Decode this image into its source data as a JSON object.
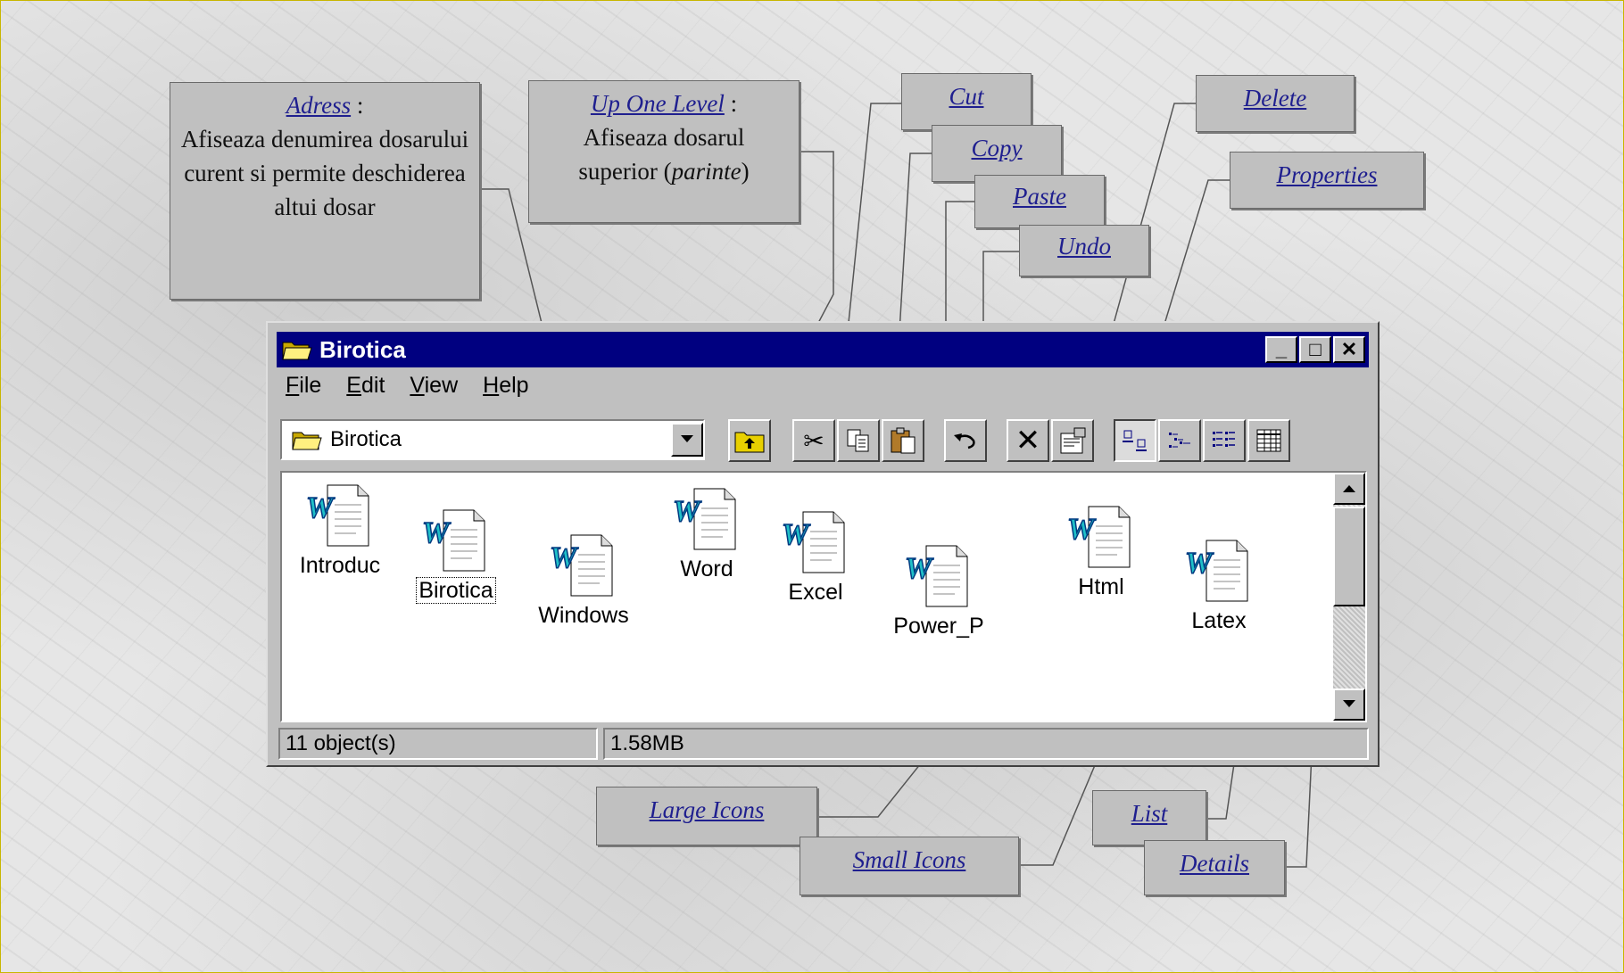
{
  "callouts": {
    "adress": {
      "title": "Adress",
      "suffix": " :",
      "body": "Afiseaza denumirea dosarului curent si permite deschiderea altui dosar"
    },
    "up_one_level": {
      "title": "Up One Level",
      "suffix": " :",
      "body_prefix": "Afiseaza dosarul superior (",
      "body_italic": "parinte",
      "body_suffix": ")"
    },
    "cut": {
      "title": "Cut"
    },
    "copy": {
      "title": "Copy"
    },
    "paste": {
      "title": "Paste"
    },
    "undo": {
      "title": "Undo"
    },
    "delete": {
      "title": "Delete"
    },
    "properties": {
      "title": "Properties"
    },
    "large_icons": {
      "title": "Large Icons"
    },
    "small_icons": {
      "title": "Small Icons"
    },
    "list": {
      "title": "List"
    },
    "details": {
      "title": "Details"
    }
  },
  "window": {
    "title": "Birotica",
    "controls": {
      "minimize": "_",
      "maximize": "□",
      "close": "✕"
    },
    "menu": [
      {
        "label": "File",
        "accel": "F",
        "rest": "ile"
      },
      {
        "label": "Edit",
        "accel": "E",
        "rest": "dit"
      },
      {
        "label": "View",
        "accel": "V",
        "rest": "iew"
      },
      {
        "label": "Help",
        "accel": "H",
        "rest": "elp"
      }
    ],
    "address_value": "Birotica",
    "toolbar": [
      "up-one-level-icon",
      "cut-icon",
      "copy-icon",
      "paste-icon",
      "undo-icon",
      "delete-icon",
      "properties-icon",
      "large-icons-icon",
      "small-icons-icon",
      "list-icon",
      "details-icon"
    ],
    "files": [
      "Introduc",
      "Birotica",
      "Windows",
      "Word",
      "Excel",
      "Power_P",
      "Html",
      "Latex"
    ],
    "selected_file": "Birotica",
    "status": {
      "objects": "11 object(s)",
      "size": "1.58MB"
    }
  }
}
